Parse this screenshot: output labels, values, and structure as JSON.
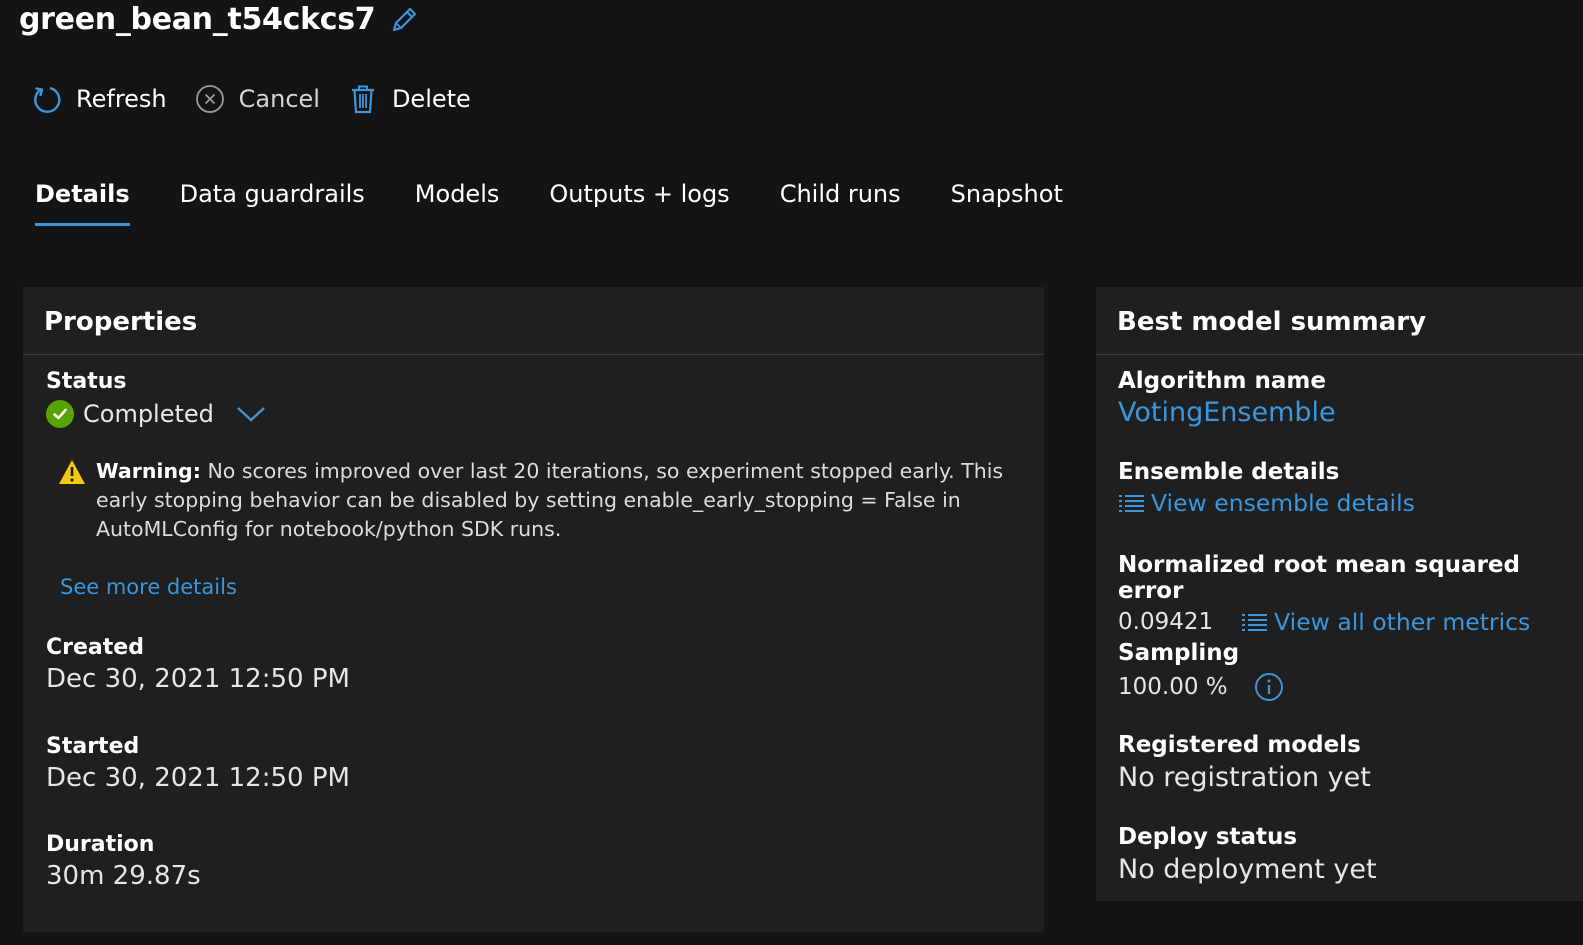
{
  "header": {
    "title": "green_bean_t54ckcs7"
  },
  "toolbar": {
    "refresh_label": "Refresh",
    "cancel_label": "Cancel",
    "delete_label": "Delete"
  },
  "tabs": [
    {
      "label": "Details",
      "active": true
    },
    {
      "label": "Data guardrails"
    },
    {
      "label": "Models"
    },
    {
      "label": "Outputs + logs"
    },
    {
      "label": "Child runs"
    },
    {
      "label": "Snapshot"
    }
  ],
  "properties": {
    "title": "Properties",
    "status_label": "Status",
    "status_value": "Completed",
    "warning_prefix": "Warning:",
    "warning_text": " No scores improved over last 20 iterations, so experiment stopped early. This early stopping behavior can be disabled by setting enable_early_stopping = False in AutoMLConfig for notebook/python SDK runs.",
    "see_more": "See more details",
    "created_label": "Created",
    "created_value": "Dec 30, 2021 12:50 PM",
    "started_label": "Started",
    "started_value": "Dec 30, 2021 12:50 PM",
    "duration_label": "Duration",
    "duration_value": "30m 29.87s"
  },
  "summary": {
    "title": "Best model summary",
    "algorithm_label": "Algorithm name",
    "algorithm_value": "VotingEnsemble",
    "ensemble_label": "Ensemble details",
    "ensemble_link": "View ensemble details",
    "nrmse_label": "Normalized root mean squared error",
    "nrmse_value": "0.09421",
    "metrics_link": "View all other metrics",
    "sampling_label": "Sampling",
    "sampling_value": "100.00 %",
    "registered_label": "Registered models",
    "registered_value": "No registration yet",
    "deploy_label": "Deploy status",
    "deploy_value": "No deployment yet"
  },
  "colors": {
    "accent": "#3a96dd",
    "success": "#57a300",
    "warning": "#f2c811",
    "background": "#141414",
    "panel": "#1f1f1f"
  }
}
